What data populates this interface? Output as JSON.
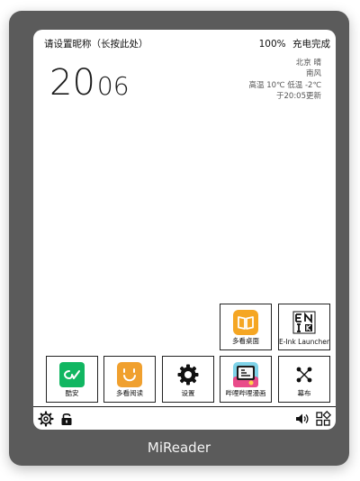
{
  "status": {
    "nickname": "请设置昵称（长按此处）",
    "battery": "100%",
    "charge_state": "充电完成"
  },
  "clock": {
    "hours": "20",
    "minutes": "06"
  },
  "weather": {
    "city_condition": "北京  晴",
    "wind": "南风",
    "temps": "高温 10℃  低温 -2℃",
    "updated": "于20:05更新"
  },
  "apps": {
    "row1": [
      {
        "label": "多看桌面",
        "icon": "book-icon"
      },
      {
        "label": "E-Ink Launcher",
        "icon": "enik-logo-icon"
      }
    ],
    "row2": [
      {
        "label": "酷安",
        "icon": "coolapk-icon"
      },
      {
        "label": "多看阅读",
        "icon": "duokan-smile-icon"
      },
      {
        "label": "设置",
        "icon": "gear-icon"
      },
      {
        "label": "哔哩哔哩漫画",
        "icon": "bilibili-comics-icon"
      },
      {
        "label": "幕布",
        "icon": "mubu-nodes-icon"
      }
    ]
  },
  "bottom_bar": {
    "icons": [
      "settings-gear-icon",
      "lock-icon",
      "volume-icon",
      "apps-grid-icon"
    ]
  },
  "device": {
    "brand": "MiReader"
  },
  "colors": {
    "device_frame": "#5b5b5b",
    "duokan_orange": "#f5a623",
    "coolapk_green": "#11b661"
  }
}
